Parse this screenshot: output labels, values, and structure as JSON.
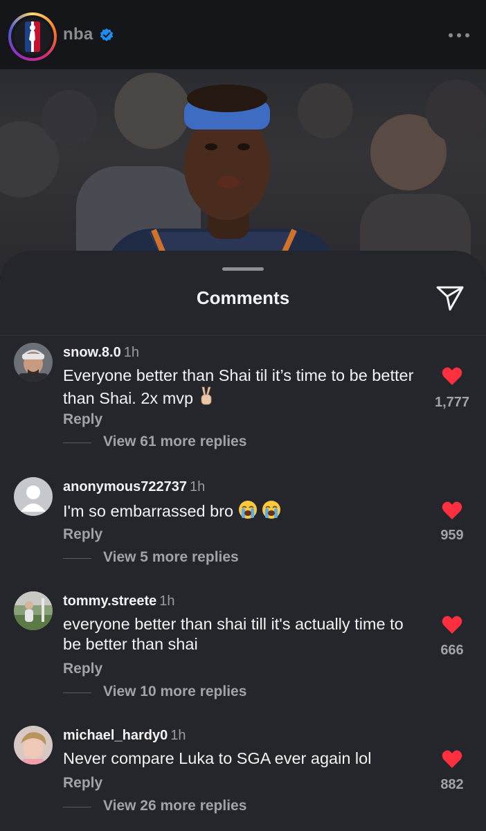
{
  "header": {
    "account_name": "nba",
    "verified": true,
    "more_menu_icon": "more-horizontal-icon"
  },
  "sheet": {
    "title": "Comments",
    "share_icon": "send-icon"
  },
  "colors": {
    "background_sheet": "#25262b",
    "text_primary": "#f3f3f5",
    "text_secondary": "#a2a3a9",
    "like_red": "#fe2f3f",
    "verified_blue": "#1d8bf0"
  },
  "comments": [
    {
      "username": "snow.8.0",
      "time": "1h",
      "text": "Everyone better than Shai til it’s time to be better than Shai. 2x mvp",
      "emoji": "victory-hand",
      "reply_label": "Reply",
      "view_replies": "View 61 more replies",
      "likes": "1,777",
      "liked": true
    },
    {
      "username": "anonymous722737",
      "time": "1h",
      "text": "I'm so embarrassed bro",
      "emoji": "loudly-crying-face x2",
      "reply_label": "Reply",
      "view_replies": "View 5 more replies",
      "likes": "959",
      "liked": true
    },
    {
      "username": "tommy.streete",
      "time": "1h",
      "text": "everyone better than shai till it's actually time to be better than shai",
      "reply_label": "Reply",
      "view_replies": "View 10 more replies",
      "likes": "666",
      "liked": true
    },
    {
      "username": "michael_hardy0",
      "time": "1h",
      "text": "Never compare Luka to SGA ever again lol",
      "reply_label": "Reply",
      "view_replies": "View 26 more replies",
      "likes": "882",
      "liked": true
    }
  ]
}
